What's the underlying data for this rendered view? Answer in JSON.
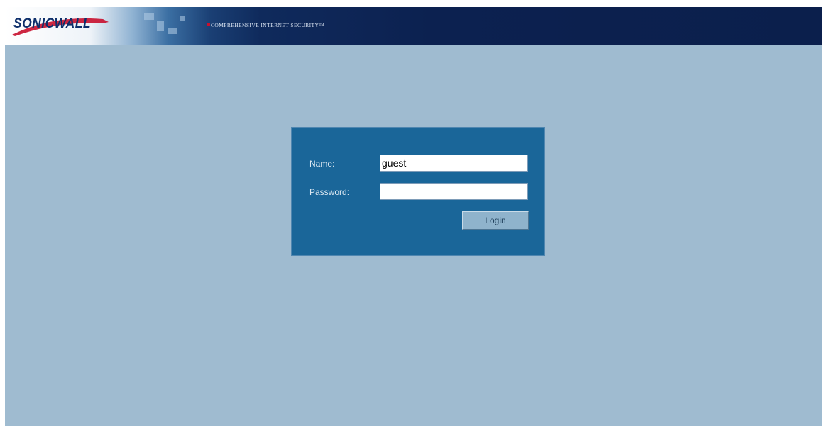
{
  "header": {
    "brand": "SONICWALL",
    "tagline": "COMPREHENSIVE INTERNET SECURITY™"
  },
  "login": {
    "name_label": "Name:",
    "name_value": "guest",
    "password_label": "Password:",
    "password_value": "",
    "login_button": "Login"
  },
  "colors": {
    "header_dark": "#0c2150",
    "page_background": "#9fbbd0",
    "panel_background": "#1a6699",
    "button_background": "#8fb3cc",
    "logo_text": "#0e2f6b",
    "tagline_bullet": "#c8102e"
  }
}
